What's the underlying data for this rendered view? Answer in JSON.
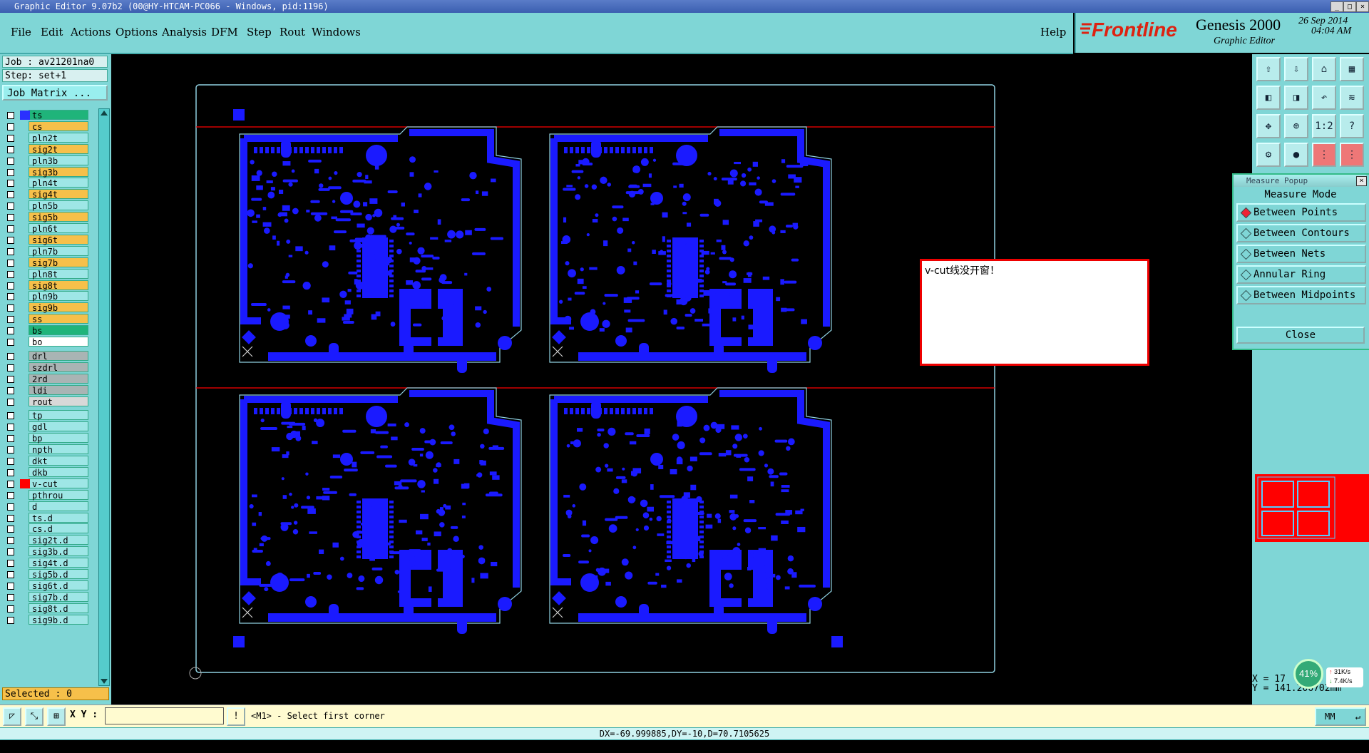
{
  "window": {
    "title": "Graphic Editor 9.07b2 (00@HY-HTCAM-PC066 - Windows, pid:1196)"
  },
  "menu": [
    "File",
    "Edit",
    "Actions",
    "Options",
    "Analysis",
    "DFM",
    "Step",
    "Rout",
    "Windows"
  ],
  "help_label": "Help",
  "brand": {
    "logo": "Frontline",
    "product": "Genesis 2000",
    "subtitle": "Graphic Editor",
    "date": "26 Sep 2014",
    "time": "04:04 AM"
  },
  "job_info": {
    "job": "Job : av21201na0",
    "step": "Step: set+1",
    "job_matrix_button": "Job Matrix ..."
  },
  "layers": [
    {
      "name": "ts",
      "color": "#1fb47a",
      "swatch": "#2a30ff"
    },
    {
      "name": "cs",
      "color": "#f6c04a",
      "swatch": ""
    },
    {
      "name": "pln2t",
      "color": "#9ee6e6",
      "swatch": ""
    },
    {
      "name": "sig2t",
      "color": "#f6c04a",
      "swatch": ""
    },
    {
      "name": "pln3b",
      "color": "#9ee6e6",
      "swatch": ""
    },
    {
      "name": "sig3b",
      "color": "#f6c04a",
      "swatch": ""
    },
    {
      "name": "pln4t",
      "color": "#9ee6e6",
      "swatch": ""
    },
    {
      "name": "sig4t",
      "color": "#f6c04a",
      "swatch": ""
    },
    {
      "name": "pln5b",
      "color": "#9ee6e6",
      "swatch": ""
    },
    {
      "name": "sig5b",
      "color": "#f6c04a",
      "swatch": ""
    },
    {
      "name": "pln6t",
      "color": "#9ee6e6",
      "swatch": ""
    },
    {
      "name": "sig6t",
      "color": "#f6c04a",
      "swatch": ""
    },
    {
      "name": "pln7b",
      "color": "#9ee6e6",
      "swatch": ""
    },
    {
      "name": "sig7b",
      "color": "#f6c04a",
      "swatch": ""
    },
    {
      "name": "pln8t",
      "color": "#9ee6e6",
      "swatch": ""
    },
    {
      "name": "sig8t",
      "color": "#f6c04a",
      "swatch": ""
    },
    {
      "name": "pln9b",
      "color": "#9ee6e6",
      "swatch": ""
    },
    {
      "name": "sig9b",
      "color": "#f6c04a",
      "swatch": ""
    },
    {
      "name": "ss",
      "color": "#f6c04a",
      "swatch": ""
    },
    {
      "name": "bs",
      "color": "#1fb47a",
      "swatch": ""
    },
    {
      "name": "bo",
      "color": "#ffffff",
      "swatch": ""
    },
    {
      "name": "drl",
      "color": "#a9b4b4",
      "swatch": ""
    },
    {
      "name": "szdrl",
      "color": "#a9b4b4",
      "swatch": ""
    },
    {
      "name": "2rd",
      "color": "#a9b4b4",
      "swatch": ""
    },
    {
      "name": "ldi",
      "color": "#a9b4b4",
      "swatch": ""
    },
    {
      "name": "rout",
      "color": "#d8d8d8",
      "swatch": ""
    },
    {
      "name": "tp",
      "color": "#9ee6e6",
      "swatch": ""
    },
    {
      "name": "gdl",
      "color": "#9ee6e6",
      "swatch": ""
    },
    {
      "name": "bp",
      "color": "#9ee6e6",
      "swatch": ""
    },
    {
      "name": "npth",
      "color": "#9ee6e6",
      "swatch": ""
    },
    {
      "name": "dkt",
      "color": "#9ee6e6",
      "swatch": ""
    },
    {
      "name": "dkb",
      "color": "#9ee6e6",
      "swatch": ""
    },
    {
      "name": "v-cut",
      "color": "#9ee6e6",
      "swatch": "#ff0000"
    },
    {
      "name": "pthrou",
      "color": "#9ee6e6",
      "swatch": ""
    },
    {
      "name": "d",
      "color": "#9ee6e6",
      "swatch": ""
    },
    {
      "name": "ts.d",
      "color": "#9ee6e6",
      "swatch": ""
    },
    {
      "name": "cs.d",
      "color": "#9ee6e6",
      "swatch": ""
    },
    {
      "name": "sig2t.d",
      "color": "#9ee6e6",
      "swatch": ""
    },
    {
      "name": "sig3b.d",
      "color": "#9ee6e6",
      "swatch": ""
    },
    {
      "name": "sig4t.d",
      "color": "#9ee6e6",
      "swatch": ""
    },
    {
      "name": "sig5b.d",
      "color": "#9ee6e6",
      "swatch": ""
    },
    {
      "name": "sig6t.d",
      "color": "#9ee6e6",
      "swatch": ""
    },
    {
      "name": "sig7b.d",
      "color": "#9ee6e6",
      "swatch": ""
    },
    {
      "name": "sig8t.d",
      "color": "#9ee6e6",
      "swatch": ""
    },
    {
      "name": "sig9b.d",
      "color": "#9ee6e6",
      "swatch": ""
    }
  ],
  "selected": "Selected : 0",
  "measure_popup": {
    "title": "Measure Popup",
    "heading": "Measure Mode",
    "options": [
      "Between Points",
      "Between Contours",
      "Between Nets",
      "Annular Ring",
      "Between Midpoints"
    ],
    "selected_index": 0,
    "close_label": "Close"
  },
  "note": "v-cut线没开窗！",
  "right_coords": {
    "x": "X = 17",
    "y": "Y = 141.206702mm"
  },
  "net_widget": {
    "percent": "41%",
    "up": "31K/s",
    "down": "7.4K/s"
  },
  "command": {
    "xy_label": "X Y :",
    "xy_value": "",
    "prompt": "<M1> - Select first corner",
    "units": "MM"
  },
  "status": "DX=-69.999885,DY=-10,D=70.7105625",
  "colors": {
    "panel": "#7fd6d6",
    "board_copper": "#1a1aff",
    "vcut": "#ff0000",
    "profile": "#8fd0e0"
  }
}
